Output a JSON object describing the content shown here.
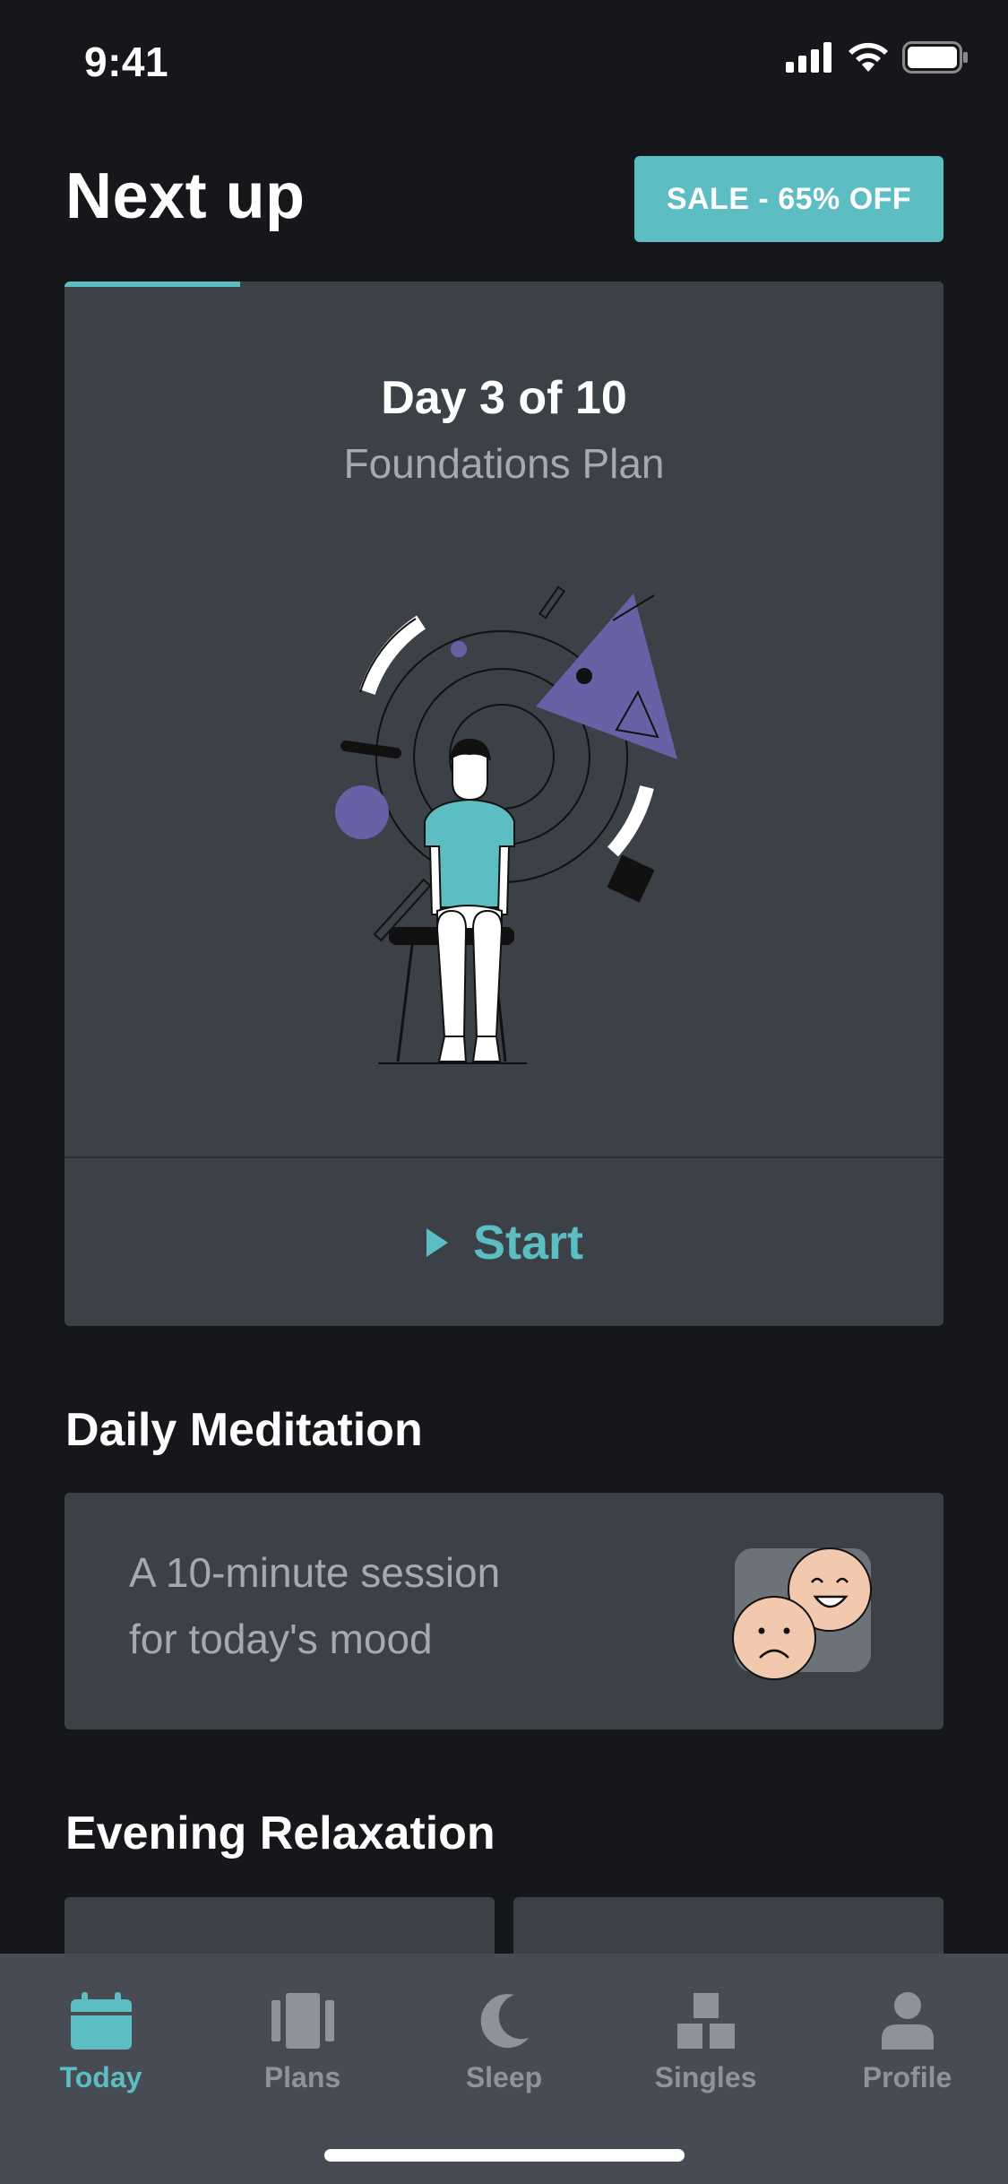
{
  "status_bar": {
    "time": "9:41"
  },
  "header": {
    "title": "Next up",
    "sale_label": "SALE - 65% OFF"
  },
  "plan_card": {
    "progress": 0.2,
    "day_label": "Day 3 of 10",
    "plan_name": "Foundations Plan",
    "start_label": "Start"
  },
  "daily_meditation": {
    "title": "Daily Meditation",
    "description_line1": "A 10-minute session",
    "description_line2": "for today's mood"
  },
  "evening_relaxation": {
    "title": "Evening Relaxation"
  },
  "tab_bar": {
    "items": [
      {
        "label": "Today",
        "icon": "calendar-icon",
        "active": true
      },
      {
        "label": "Plans",
        "icon": "plans-icon",
        "active": false
      },
      {
        "label": "Sleep",
        "icon": "moon-icon",
        "active": false
      },
      {
        "label": "Singles",
        "icon": "blocks-icon",
        "active": false
      },
      {
        "label": "Profile",
        "icon": "person-icon",
        "active": false
      }
    ]
  },
  "colors": {
    "accent": "#5cbdc3",
    "background": "#16171a",
    "card": "#3c4047",
    "tab_bar": "#474c54",
    "muted_text": "#a6a9ae",
    "illustration_purple": "#6762a6",
    "face": "#f2c9ae"
  }
}
